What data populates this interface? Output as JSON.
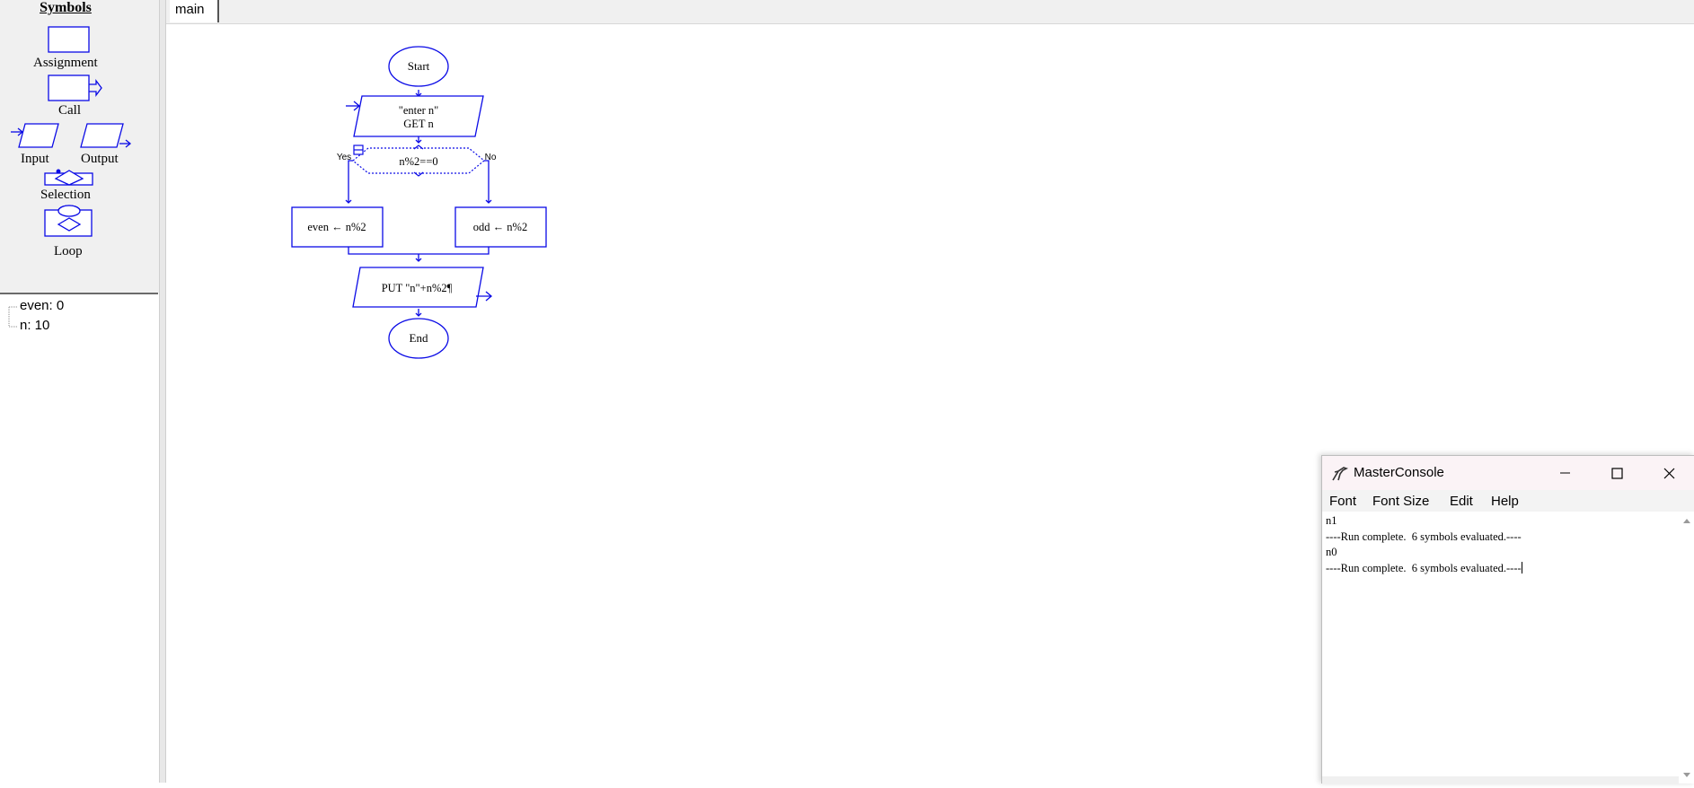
{
  "palette": {
    "title": "Symbols",
    "items": {
      "assignment": "Assignment",
      "call": "Call",
      "input": "Input",
      "output": "Output",
      "selection": "Selection",
      "loop": "Loop"
    }
  },
  "variables": [
    {
      "label": "even: 0"
    },
    {
      "label": "n: 10"
    }
  ],
  "tabs": [
    {
      "label": "main",
      "active": true
    }
  ],
  "flowchart": {
    "start": "Start",
    "input_prompt": "\"enter n\"",
    "input_stmt": "GET n",
    "decision": "n%2==0",
    "yes_label": "Yes",
    "no_label": "No",
    "yes_assign": "even ← n%2",
    "no_assign": "odd ← n%2",
    "output_stmt": "PUT \"n\"+n%2¶",
    "end": "End"
  },
  "console": {
    "title": "MasterConsole",
    "menu": [
      "Font",
      "Font Size",
      "Edit",
      "Help"
    ],
    "output_lines": [
      "n1",
      "----Run complete.  6 symbols evaluated.----",
      "n0",
      "----Run complete.  6 symbols evaluated.----"
    ]
  },
  "colors": {
    "flow_stroke": "#0a0ae6",
    "panel_bg": "#f0f0f0"
  }
}
